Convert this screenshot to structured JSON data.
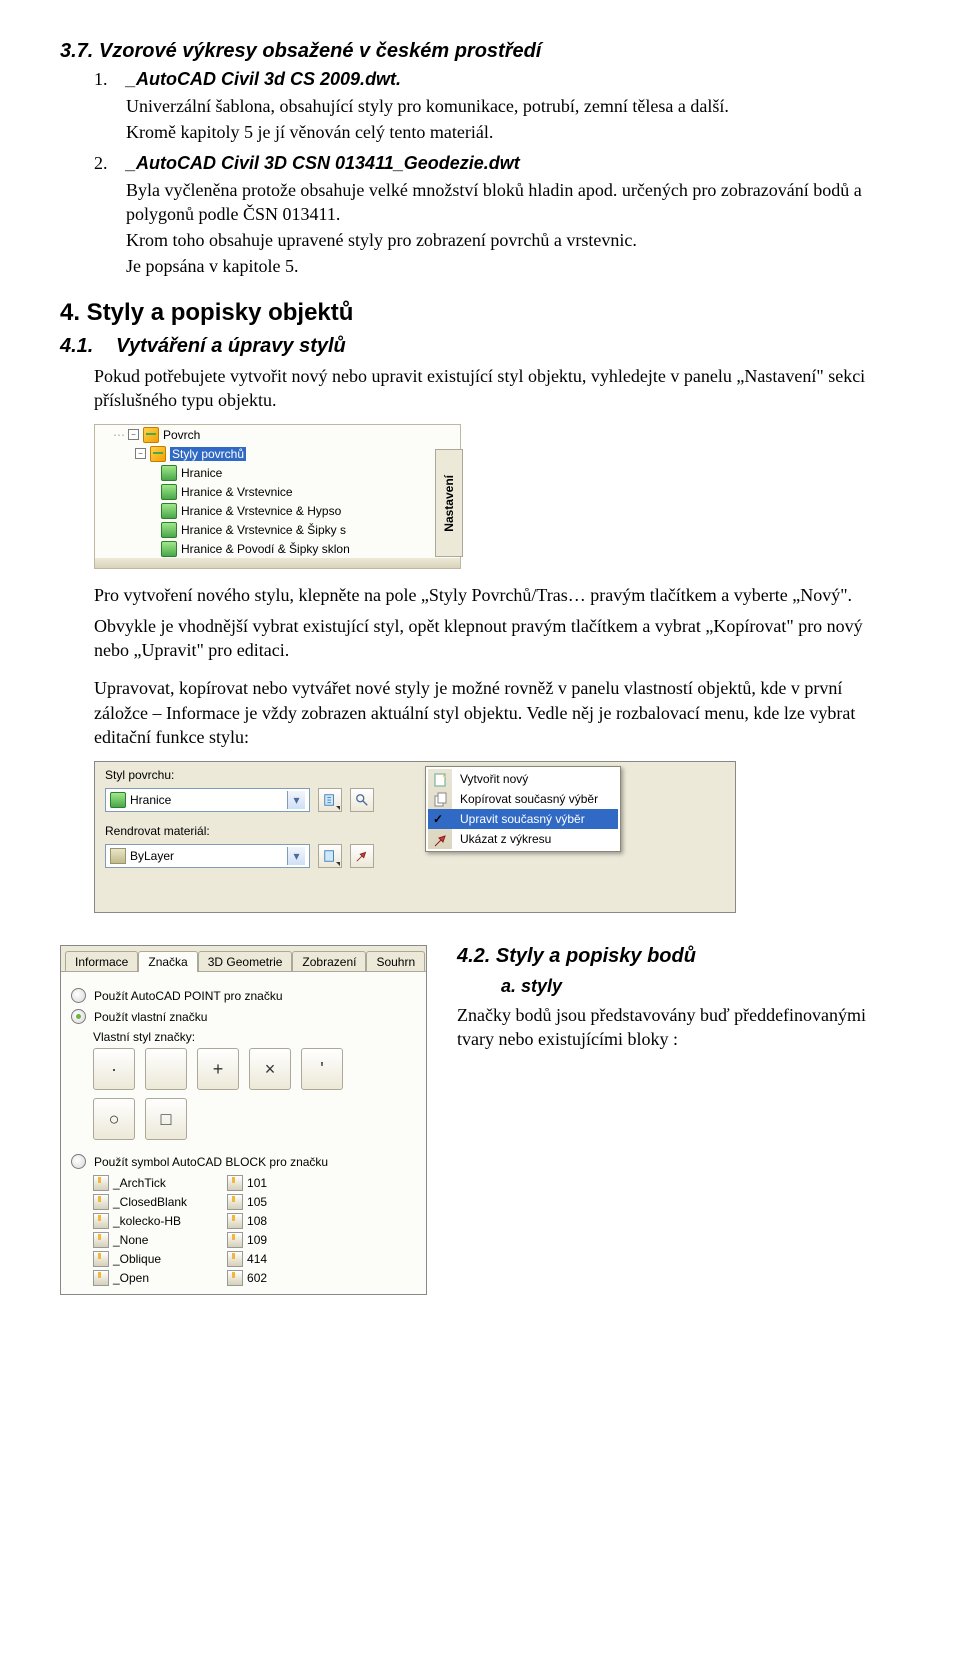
{
  "s37": {
    "heading": "3.7.  Vzorové výkresy obsažené v českém prostředí",
    "item1_title": "_AutoCAD Civil 3d CS 2009.dwt.",
    "item1_p1": "Univerzální šablona, obsahující styly pro komunikace, potrubí, zemní tělesa a další.",
    "item1_p2": "Kromě kapitoly 5 je jí věnován celý tento materiál.",
    "item2_title": "_AutoCAD Civil 3D CSN 013411_Geodezie.dwt",
    "item2_p1": "Byla vyčleněna protože obsahuje velké množství bloků hladin apod. určených pro zobrazování bodů a polygonů podle ČSN 013411.",
    "item2_p2": "Krom toho obsahuje upravené styly pro zobrazení povrchů a vrstevnic.",
    "item2_p3": "Je popsána v kapitole 5."
  },
  "s4": {
    "heading": "4. Styly a popisky objektů"
  },
  "s41": {
    "heading": "Vytváření a úpravy stylů",
    "num": "4.1.",
    "p1": "Pokud potřebujete vytvořit nový nebo upravit existující styl objektu, vyhledejte v panelu „Nastavení\" sekci příslušného typu objektu.",
    "after_panel_p1": "Pro vytvoření nového stylu, klepněte na pole „Styly Povrchů/Tras… pravým tlačítkem a vyberte „Nový\".",
    "after_panel_p2": "Obvykle je vhodnější vybrat existující styl, opět klepnout pravým tlačítkem a vybrat „Kopírovat\" pro nový nebo „Upravit\" pro editaci.",
    "p3": "Upravovat, kopírovat nebo vytvářet nové styly je možné rovněž v panelu vlastností objektů, kde v první záložce – Informace je vždy zobrazen aktuální styl objektu. Vedle něj je rozbalovací menu, kde lze vybrat editační funkce stylu:"
  },
  "tree": {
    "root": "Povrch",
    "group": "Styly povrchů",
    "items": [
      "Hranice",
      "Hranice & Vrstevnice",
      "Hranice & Vrstevnice & Hypso",
      "Hranice & Vrstevnice & Šipky s",
      "Hranice & Povodí & Šipky sklon"
    ],
    "sidebar_tab": "Nastavení"
  },
  "prop": {
    "label1": "Styl povrchu:",
    "combo1": "Hranice",
    "label2": "Rendrovat materiál:",
    "combo2": "ByLayer"
  },
  "ctx": {
    "i1": "Vytvořit nový",
    "i2": "Kopírovat současný výběr",
    "i3": "Upravit současný výběr",
    "i4": "Ukázat z výkresu"
  },
  "s42": {
    "heading": "4.2.  Styly a popisky  bodů",
    "a_label": "a.   styly",
    "p1": "Značky bodů jsou představovány buď předdefinovanými tvary nebo existujícími bloky :"
  },
  "tabs": {
    "t1": "Informace",
    "t2": "Značka",
    "t3": "3D Geometrie",
    "t4": "Zobrazení",
    "t5": "Souhrn",
    "r1": "Použít AutoCAD POINT pro značku",
    "r2": "Použít vlastní značku",
    "sub": "Vlastní styl značky:",
    "r3": "Použít symbol AutoCAD BLOCK pro značku"
  },
  "blocks": {
    "left": [
      "_ArchTick",
      "_ClosedBlank",
      "_kolecko-HB",
      "_None",
      "_Oblique",
      "_Open"
    ],
    "right": [
      "101",
      "105",
      "108",
      "109",
      "414",
      "602"
    ]
  }
}
